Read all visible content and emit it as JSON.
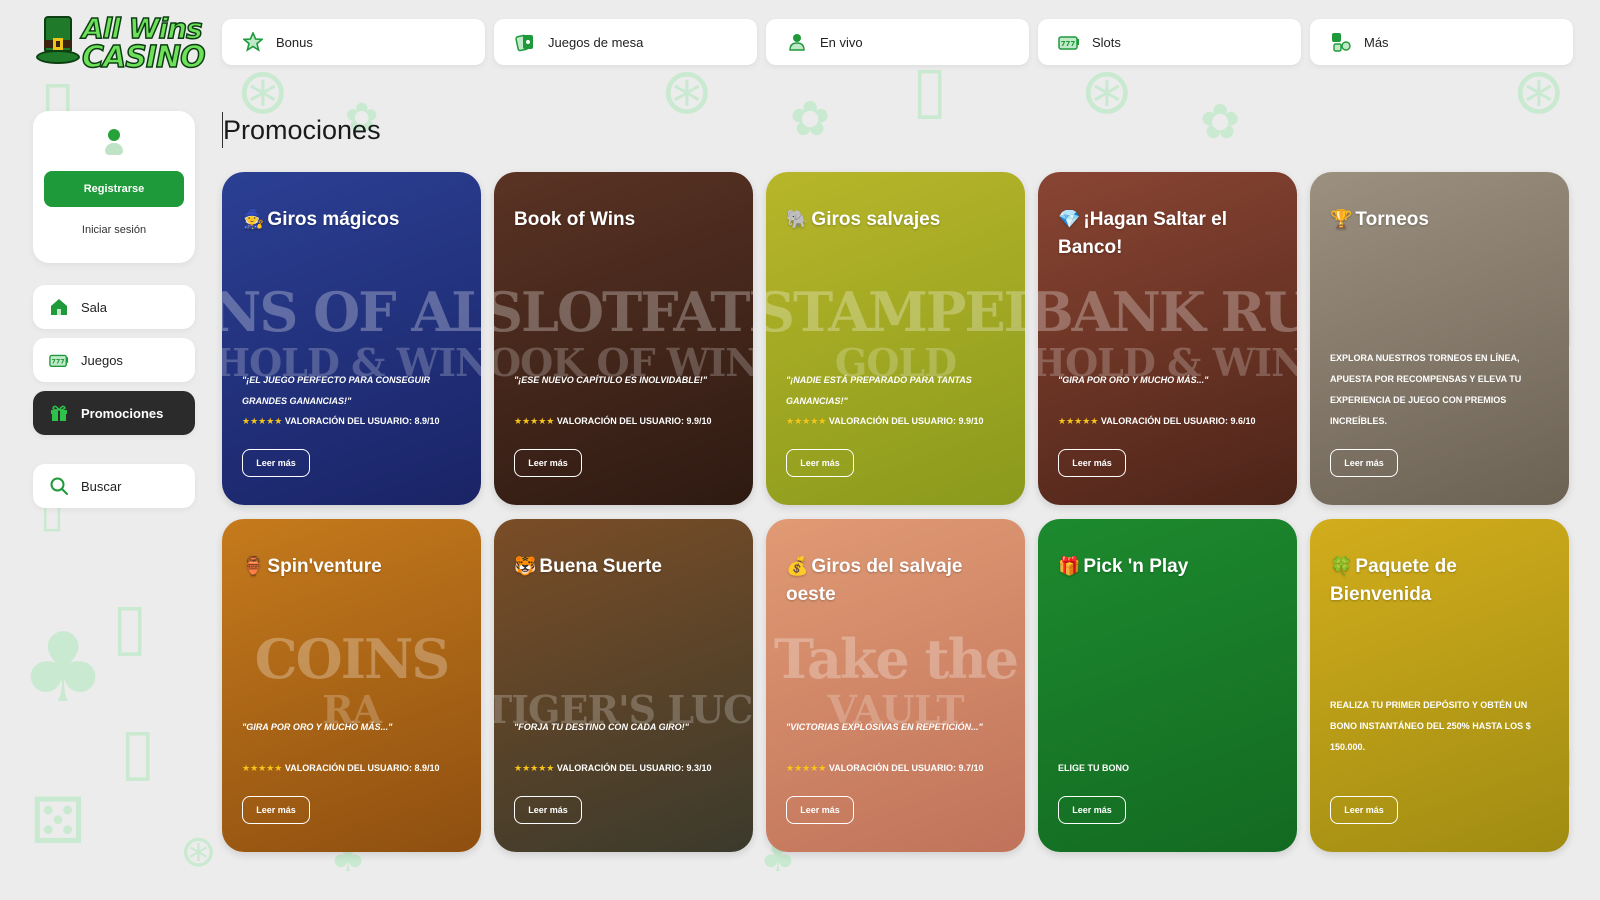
{
  "logo": {
    "line1": "All Wins",
    "line2": "CASINO"
  },
  "topnav": [
    {
      "label": "Bonus",
      "icon": "star-icon"
    },
    {
      "label": "Juegos de mesa",
      "icon": "cards-icon"
    },
    {
      "label": "En vivo",
      "icon": "live-dealer-icon"
    },
    {
      "label": "Slots",
      "icon": "slot-machine-icon"
    },
    {
      "label": "Más",
      "icon": "more-games-icon"
    }
  ],
  "auth": {
    "register_label": "Registrarse",
    "login_label": "Iniciar sesión"
  },
  "sidebar": {
    "items": [
      {
        "label": "Sala",
        "icon": "home-icon"
      },
      {
        "label": "Juegos",
        "icon": "slot-machine-icon"
      },
      {
        "label": "Promociones",
        "icon": "gift-icon",
        "active": true
      }
    ],
    "search_label": "Buscar"
  },
  "page_title": "Promociones",
  "more_label": "Leer más",
  "promos": [
    {
      "title": "Giros mágicos",
      "emoji": "🧙",
      "art": "NS OF ALK",
      "art2": "HOLD & WIN",
      "desc": "\"¡El juego perfecto para conseguir grandes ganancias!\"",
      "stars": "★★★★★",
      "rating": "VALORACIÓN DEL USUARIO: 8.9/10",
      "bg": "#2b3f93",
      "bg2": "#1a2466"
    },
    {
      "title": "Book of Wins",
      "emoji": "",
      "art": "SLOTFATH",
      "art2": "OOK OF WIN",
      "desc": "\"¡Ese nuevo capítulo es inolvidable!\"",
      "stars": "★★★★★",
      "rating": "VALORACIÓN DEL USUARIO: 9.9/10",
      "bg": "#5a3324",
      "bg2": "#2e1a12"
    },
    {
      "title": "Giros salvajes",
      "emoji": "🐘",
      "art": "STAMPEDE",
      "art2": "GOLD",
      "desc": "\"¡Nadie está preparado para tantas ganancias!\"",
      "stars": "★★★★★",
      "rating": "VALORACIÓN DEL USUARIO: 9.9/10",
      "bg": "#b8b62a",
      "bg2": "#8a9a1c"
    },
    {
      "title": "¡Hagan Saltar el Banco!",
      "emoji": "💎",
      "art": "BANK RUSH",
      "art2": "HOLD & WIN",
      "desc": "\"Gira por oro y mucho más...\"",
      "stars": "★★★★★",
      "rating": "VALORACIÓN DEL USUARIO: 9.6/10",
      "bg": "#8a4533",
      "bg2": "#4c2418"
    },
    {
      "title": "Torneos",
      "emoji": "🏆",
      "art": "",
      "art2": "",
      "desc": "Explora nuestros torneos en línea, apuesta por recompensas y eleva tu experiencia de juego con premios increíbles.",
      "stars": "",
      "rating": "",
      "bg": "#9c9080",
      "bg2": "#6c6254"
    },
    {
      "title": "Spin'venture",
      "emoji": "🏺",
      "art": "COINS",
      "art2": "RA",
      "desc": "\"Gira por oro y mucho más...\"",
      "stars": "★★★★★",
      "rating": "VALORACIÓN DEL USUARIO: 8.9/10",
      "bg": "#c57a1c",
      "bg2": "#8e4f10"
    },
    {
      "title": "Buena Suerte",
      "emoji": "🐯",
      "art": "",
      "art2": "TIGER'S LUCK",
      "desc": "\"Forja tu destino con cada giro!\"",
      "stars": "★★★★★",
      "rating": "VALORACIÓN DEL USUARIO: 9.3/10",
      "bg": "#7a4d26",
      "bg2": "#3b3a2c"
    },
    {
      "title": "Giros del salvaje oeste",
      "emoji": "💰",
      "art": "Take the",
      "art2": "VAULT",
      "desc": "\"Victorias explosivas en repetición...\"",
      "stars": "★★★★★",
      "rating": "VALORACIÓN DEL USUARIO: 9.7/10",
      "bg": "#e09a74",
      "bg2": "#c0735a"
    },
    {
      "title": "Pick 'n Play",
      "emoji": "🎁",
      "art": "",
      "art2": "",
      "desc": "ELIGE TU BONO",
      "stars": "",
      "rating": "",
      "bg": "#1d8a2e",
      "bg2": "#136a22"
    },
    {
      "title": "Paquete de Bienvenida",
      "emoji": "🍀",
      "art": "",
      "art2": "",
      "desc": "Realiza tu primer depósito y obtén un bono instantáneo del 250% hasta los $ 150.000.",
      "stars": "",
      "rating": "",
      "bg": "#d2ad1c",
      "bg2": "#a08c12"
    }
  ]
}
